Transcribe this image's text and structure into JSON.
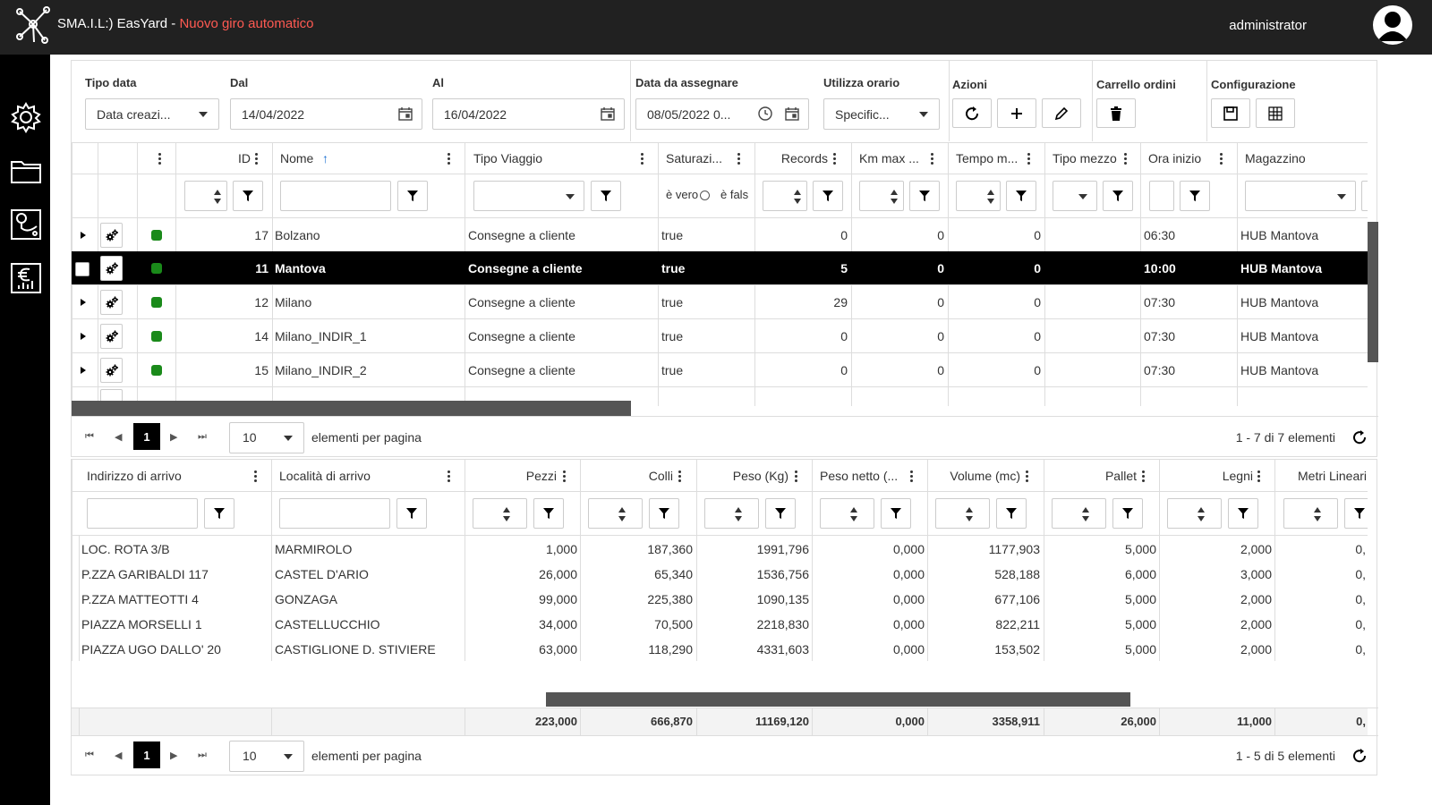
{
  "app": {
    "brand": "SMA.I.L:) EasYard -",
    "subtitle": "Nuovo giro automatico",
    "user": "administrator"
  },
  "sidebar": {
    "items": [
      {
        "icon": "gear-icon"
      },
      {
        "icon": "folder-icon"
      },
      {
        "icon": "map-route-icon"
      },
      {
        "icon": "euro-report-icon"
      }
    ]
  },
  "filters": {
    "tipo_data": {
      "label": "Tipo data",
      "value": "Data creazi..."
    },
    "dal": {
      "label": "Dal",
      "value": "14/04/2022"
    },
    "al": {
      "label": "Al",
      "value": "16/04/2022"
    },
    "data_assegnare": {
      "label": "Data da assegnare",
      "value": "08/05/2022 0..."
    },
    "utilizza_orario": {
      "label": "Utilizza orario",
      "value": "Specific..."
    },
    "azioni": {
      "label": "Azioni"
    },
    "carrello": {
      "label": "Carrello ordini"
    },
    "configurazione": {
      "label": "Configurazione"
    }
  },
  "tours": {
    "columns": {
      "id": "ID",
      "nome": "Nome",
      "tipo_viaggio": "Tipo Viaggio",
      "saturazione": "Saturazi...",
      "records": "Records",
      "km_max": "Km max ...",
      "tempo": "Tempo m...",
      "tipo_mezzo": "Tipo mezzo",
      "ora_inizio": "Ora inizio",
      "magazzino": "Magazzino"
    },
    "bool_filter": {
      "true_label": "è vero",
      "false_label": "è fals"
    },
    "rows": [
      {
        "id": "17",
        "nome": "Bolzano",
        "tipo": "Consegne a cliente",
        "sat": "true",
        "records": "0",
        "km": "0",
        "tempo": "0",
        "mezzo": "",
        "ora": "06:30",
        "mag": "HUB Mantova"
      },
      {
        "id": "11",
        "nome": "Mantova",
        "tipo": "Consegne a cliente",
        "sat": "true",
        "records": "5",
        "km": "0",
        "tempo": "0",
        "mezzo": "",
        "ora": "10:00",
        "mag": "HUB Mantova"
      },
      {
        "id": "12",
        "nome": "Milano",
        "tipo": "Consegne a cliente",
        "sat": "true",
        "records": "29",
        "km": "0",
        "tempo": "0",
        "mezzo": "",
        "ora": "07:30",
        "mag": "HUB Mantova"
      },
      {
        "id": "14",
        "nome": "Milano_INDIR_1",
        "tipo": "Consegne a cliente",
        "sat": "true",
        "records": "0",
        "km": "0",
        "tempo": "0",
        "mezzo": "",
        "ora": "07:30",
        "mag": "HUB Mantova"
      },
      {
        "id": "15",
        "nome": "Milano_INDIR_2",
        "tipo": "Consegne a cliente",
        "sat": "true",
        "records": "0",
        "km": "0",
        "tempo": "0",
        "mezzo": "",
        "ora": "07:30",
        "mag": "HUB Mantova"
      }
    ],
    "pager": {
      "page": "1",
      "page_size": "10",
      "per_page_label": "elementi per pagina",
      "summary": "1 - 7 di 7 elementi"
    }
  },
  "details": {
    "columns": {
      "indirizzo": "Indirizzo di arrivo",
      "localita": "Località di arrivo",
      "pezzi": "Pezzi",
      "colli": "Colli",
      "peso": "Peso (Kg)",
      "peso_netto": "Peso netto (...",
      "volume": "Volume (mc)",
      "pallet": "Pallet",
      "legni": "Legni",
      "metri": "Metri Lineari"
    },
    "rows": [
      {
        "ind": "LOC. ROTA 3/B",
        "loc": "MARMIROLO",
        "pezzi": "1,000",
        "colli": "187,360",
        "peso": "1991,796",
        "netto": "0,000",
        "vol": "1177,903",
        "pallet": "5,000",
        "legni": "2,000",
        "metri": "0,"
      },
      {
        "ind": "P.ZZA GARIBALDI 117",
        "loc": "CASTEL D'ARIO",
        "pezzi": "26,000",
        "colli": "65,340",
        "peso": "1536,756",
        "netto": "0,000",
        "vol": "528,188",
        "pallet": "6,000",
        "legni": "3,000",
        "metri": "0,"
      },
      {
        "ind": "P.ZZA MATTEOTTI 4",
        "loc": "GONZAGA",
        "pezzi": "99,000",
        "colli": "225,380",
        "peso": "1090,135",
        "netto": "0,000",
        "vol": "677,106",
        "pallet": "5,000",
        "legni": "2,000",
        "metri": "0,"
      },
      {
        "ind": "PIAZZA MORSELLI 1",
        "loc": "CASTELLUCCHIO",
        "pezzi": "34,000",
        "colli": "70,500",
        "peso": "2218,830",
        "netto": "0,000",
        "vol": "822,211",
        "pallet": "5,000",
        "legni": "2,000",
        "metri": "0,"
      },
      {
        "ind": "PIAZZA UGO DALLO' 20",
        "loc": "CASTIGLIONE D. STIVIERE",
        "pezzi": "63,000",
        "colli": "118,290",
        "peso": "4331,603",
        "netto": "0,000",
        "vol": "153,502",
        "pallet": "5,000",
        "legni": "2,000",
        "metri": "0,"
      }
    ],
    "totals": {
      "pezzi": "223,000",
      "colli": "666,870",
      "peso": "11169,120",
      "netto": "0,000",
      "vol": "3358,911",
      "pallet": "26,000",
      "legni": "11,000",
      "metri": "0,"
    },
    "pager": {
      "page": "1",
      "page_size": "10",
      "per_page_label": "elementi per pagina",
      "summary": "1 - 5 di 5 elementi"
    }
  },
  "colors": {
    "topbar": "#212121",
    "accent": "#ff5a52",
    "selected_row": "#000000",
    "status_green": "#1a8a1a"
  }
}
